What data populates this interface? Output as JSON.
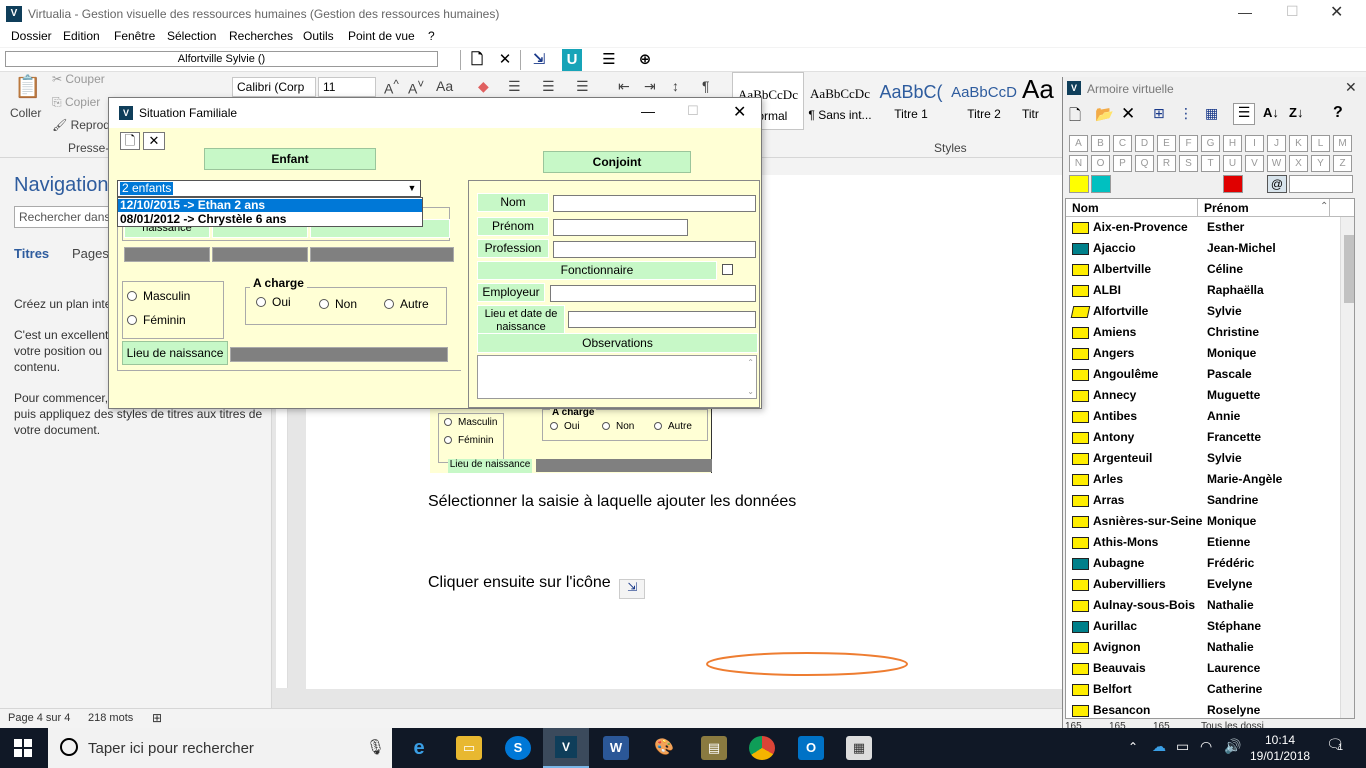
{
  "window": {
    "title": "Virtualia - Gestion visuelle des ressources humaines  (Gestion des ressources humaines)"
  },
  "menu": [
    "Dossier",
    "Edition",
    "Fenêtre",
    "Sélection",
    "Recherches",
    "Outils",
    "Point de vue",
    "?"
  ],
  "toolbar": {
    "current_record": "Alfortville  Sylvie  ()"
  },
  "word": {
    "clipboard": {
      "paste": "Coller",
      "cut": "Couper",
      "copy": "Copier",
      "format": "Reprodu",
      "group": "Presse-p"
    },
    "font": {
      "name": "Calibri (Corp",
      "size": "11"
    },
    "styles_group": "Styles",
    "styles": [
      {
        "sample": "AaBbCcDc",
        "name": "Normal"
      },
      {
        "sample": "AaBbCcDc",
        "name": "¶ Sans int..."
      },
      {
        "sample": "AaBbC(",
        "name": "Titre 1"
      },
      {
        "sample": "AaBbCcD",
        "name": "Titre 2"
      },
      {
        "sample": "Aa",
        "name": "Titr"
      }
    ],
    "nav": {
      "title": "Navigation",
      "search_placeholder": "Rechercher dans",
      "tabs": [
        "Titres",
        "Pages"
      ],
      "p1": "Créez un plan inte",
      "p2a": "C'est un excellent",
      "p2b": "votre position ou",
      "p2c": "contenu.",
      "p3a": "Pour commencer,",
      "p3b": "puis appliquez des styles de titres aux titres de",
      "p3c": "votre document."
    },
    "doc": {
      "line1": "Sélectionner la saisie à laquelle ajouter les données",
      "line2": "Cliquer ensuite sur l'icône",
      "embedded": {
        "masculin": "Masculin",
        "feminin": "Féminin",
        "a_charge": "A charge",
        "oui": "Oui",
        "non": "Non",
        "autre": "Autre",
        "lieu": "Lieu de naissance"
      }
    },
    "status": {
      "page": "Page 4 sur 4",
      "words": "218 mots"
    }
  },
  "dialog": {
    "title": "Situation Familiale",
    "tab_enfant": "Enfant",
    "tab_conjoint": "Conjoint",
    "combo_value": "2 enfants",
    "dropdown_items": [
      "12/10/2015 -> Ethan 2 ans",
      "08/01/2012 -> Chrystèle 6 ans"
    ],
    "enfant": {
      "naissance": "naissance",
      "masculin": "Masculin",
      "feminin": "Féminin",
      "a_charge": "A charge",
      "oui": "Oui",
      "non": "Non",
      "autre": "Autre",
      "lieu_naissance": "Lieu de naissance"
    },
    "conjoint": {
      "nom": "Nom",
      "prenom": "Prénom",
      "profession": "Profession",
      "fonctionnaire": "Fonctionnaire",
      "employeur": "Employeur",
      "lieu_date": "Lieu et date de naissance",
      "observations": "Observations"
    }
  },
  "armoire": {
    "title": "Armoire virtuelle",
    "letters_row1": [
      "A",
      "B",
      "C",
      "D",
      "E",
      "F",
      "G",
      "H",
      "I",
      "J",
      "K",
      "L",
      "M"
    ],
    "letters_row2": [
      "N",
      "O",
      "P",
      "Q",
      "R",
      "S",
      "T",
      "U",
      "V",
      "W",
      "X",
      "Y",
      "Z"
    ],
    "colors": [
      "#ffff00",
      "#00c0c0",
      "#e00000"
    ],
    "at_symbol": "@",
    "col_nom": "Nom",
    "col_prenom": "Prénom",
    "rows": [
      {
        "nom": "Aix-en-Provence",
        "prenom": "Esther",
        "folder": "yellow"
      },
      {
        "nom": "Ajaccio",
        "prenom": "Jean-Michel",
        "folder": "teal"
      },
      {
        "nom": "Albertville",
        "prenom": "Céline",
        "folder": "yellow"
      },
      {
        "nom": "ALBI",
        "prenom": "Raphaëlla",
        "folder": "yellow"
      },
      {
        "nom": "Alfortville",
        "prenom": "Sylvie",
        "folder": "open"
      },
      {
        "nom": "Amiens",
        "prenom": "Christine",
        "folder": "yellow"
      },
      {
        "nom": "Angers",
        "prenom": "Monique",
        "folder": "yellow"
      },
      {
        "nom": "Angoulême",
        "prenom": "Pascale",
        "folder": "yellow"
      },
      {
        "nom": "Annecy",
        "prenom": "Muguette",
        "folder": "yellow"
      },
      {
        "nom": "Antibes",
        "prenom": "Annie",
        "folder": "yellow"
      },
      {
        "nom": "Antony",
        "prenom": "Francette",
        "folder": "yellow"
      },
      {
        "nom": "Argenteuil",
        "prenom": "Sylvie",
        "folder": "yellow"
      },
      {
        "nom": "Arles",
        "prenom": "Marie-Angèle",
        "folder": "yellow"
      },
      {
        "nom": "Arras",
        "prenom": "Sandrine",
        "folder": "yellow"
      },
      {
        "nom": "Asnières-sur-Seine",
        "prenom": "Monique",
        "folder": "yellow"
      },
      {
        "nom": "Athis-Mons",
        "prenom": "Etienne",
        "folder": "yellow"
      },
      {
        "nom": "Aubagne",
        "prenom": "Frédéric",
        "folder": "teal"
      },
      {
        "nom": "Aubervilliers",
        "prenom": "Evelyne",
        "folder": "yellow"
      },
      {
        "nom": "Aulnay-sous-Bois",
        "prenom": "Nathalie",
        "folder": "yellow"
      },
      {
        "nom": "Aurillac",
        "prenom": "Stéphane",
        "folder": "teal"
      },
      {
        "nom": "Avignon",
        "prenom": "Nathalie",
        "folder": "yellow"
      },
      {
        "nom": "Beauvais",
        "prenom": "Laurence",
        "folder": "yellow"
      },
      {
        "nom": "Belfort",
        "prenom": "Catherine",
        "folder": "yellow"
      },
      {
        "nom": "Besancon",
        "prenom": "Roselyne",
        "folder": "yellow"
      }
    ],
    "status": [
      "165",
      "165",
      "165",
      "Tous les dossi"
    ]
  },
  "taskbar": {
    "search_placeholder": "Taper ici pour rechercher",
    "time": "10:14",
    "date": "19/01/2018",
    "notifications": "1"
  }
}
